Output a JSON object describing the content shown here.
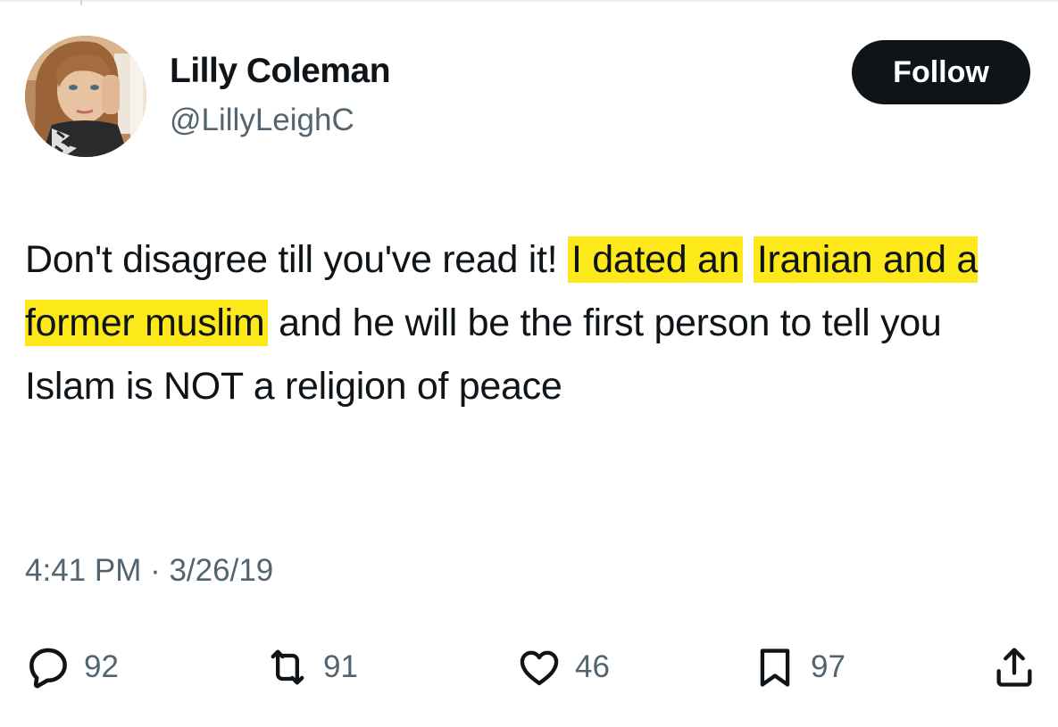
{
  "author": {
    "name": "Lilly Coleman",
    "handle": "@LillyLeighC",
    "follow_label": "Follow"
  },
  "tweet": {
    "text_before": "Don't disagree till you've read it! ",
    "highlighted_line1": "I dated an",
    "highlighted_line2": "Iranian and a former muslim",
    "text_after": " and he will be the first person to tell you Islam is NOT a religion of peace",
    "highlight_color": "#fde81a"
  },
  "timestamp": {
    "time": "4:41 PM",
    "separator": " · ",
    "date": "3/26/19"
  },
  "actions": {
    "replies": {
      "icon": "reply-icon",
      "count": "92"
    },
    "retweets": {
      "icon": "retweet-icon",
      "count": "91"
    },
    "likes": {
      "icon": "heart-icon",
      "count": "46"
    },
    "bookmarks": {
      "icon": "bookmark-icon",
      "count": "97"
    },
    "share": {
      "icon": "share-icon"
    }
  },
  "colors": {
    "text": "#0f1419",
    "secondary": "#536471",
    "button_bg": "#0f1419",
    "button_text": "#ffffff"
  }
}
